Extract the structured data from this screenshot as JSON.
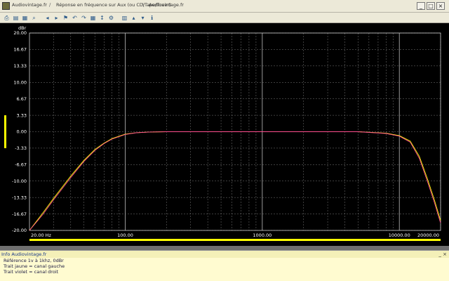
{
  "titlebar": {
    "segments": [
      "Audiovintage.fr",
      "Réponse en fréquence sur Aux (ou CD/Tape/Tuner)",
      "Audiovintage.fr"
    ],
    "separators": [
      "/",
      "\\"
    ]
  },
  "toolbar": {
    "icons": [
      "print-icon",
      "save-icon",
      "open-icon",
      "zoom-icon",
      "cursor-left-icon",
      "cursor-right-icon",
      "marker-icon",
      "undo-icon",
      "redo-icon",
      "grid-icon",
      "scale-icon",
      "settings-icon",
      "chart-icon",
      "channel-left-icon",
      "channel-right-icon",
      "info-icon"
    ]
  },
  "chart_data": {
    "type": "line",
    "title": "",
    "ylabel": "dBr",
    "xlabel": "",
    "xscale": "log",
    "xlim": [
      20,
      20000
    ],
    "ylim": [
      -20,
      20
    ],
    "grid": true,
    "ytick_labels": [
      "20.00",
      "16.67",
      "13.33",
      "10.00",
      "6.67",
      "3.33",
      "0.00",
      "-3.33",
      "-6.67",
      "-10.00",
      "-13.33",
      "-16.67",
      "-20.00"
    ],
    "yticks": [
      20,
      16.67,
      13.33,
      10,
      6.67,
      3.33,
      0,
      -3.33,
      -6.67,
      -10,
      -13.33,
      -16.67,
      -20
    ],
    "xtick_labels": [
      "20.00 Hz",
      "100.00",
      "1000.00",
      "10000.00",
      "20000.00"
    ],
    "xticks": [
      20,
      100,
      1000,
      10000,
      20000
    ],
    "series": [
      {
        "color": "#ffff00",
        "x": [
          20,
          25,
          30,
          40,
          50,
          60,
          70,
          80,
          100,
          120,
          150,
          200,
          500,
          1000,
          2000,
          5000,
          8000,
          10000,
          12000,
          14000,
          16000,
          18000,
          20000
        ],
        "y": [
          -20,
          -16.5,
          -13.5,
          -9.0,
          -5.8,
          -3.6,
          -2.3,
          -1.4,
          -0.5,
          -0.2,
          -0.05,
          0,
          0,
          0,
          0,
          0,
          -0.3,
          -0.8,
          -1.9,
          -5.0,
          -9.5,
          -13.8,
          -18.0
        ]
      },
      {
        "color": "#ff4f8f",
        "x": [
          20,
          25,
          30,
          40,
          50,
          60,
          70,
          80,
          100,
          120,
          150,
          200,
          500,
          1000,
          2000,
          5000,
          8000,
          10000,
          12000,
          14000,
          16000,
          18000,
          20000
        ],
        "y": [
          -20,
          -16.8,
          -13.8,
          -9.3,
          -6.0,
          -3.8,
          -2.4,
          -1.5,
          -0.55,
          -0.22,
          -0.06,
          0,
          0,
          0,
          0,
          0,
          -0.35,
          -0.9,
          -2.1,
          -5.4,
          -10.0,
          -14.3,
          -18.5
        ]
      }
    ]
  },
  "info": {
    "title": "Info Audiovintage.fr",
    "lines": [
      "Référence 1v à 1khz, 0dBr",
      "Trait jaune = canal gauche",
      "Trait violet = canal droit"
    ]
  }
}
